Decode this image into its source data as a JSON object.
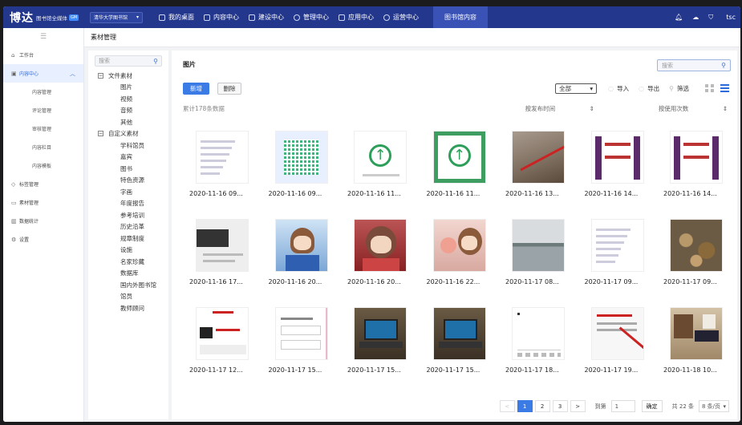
{
  "topbar": {
    "logo": "博达",
    "logo_sub": "图书馆全媒体",
    "logo_badge": "GM",
    "org": "清华大学图书馆",
    "nav": [
      {
        "label": "我的桌面",
        "icon": "desktop-icon"
      },
      {
        "label": "内容中心",
        "icon": "content-icon"
      },
      {
        "label": "建设中心",
        "icon": "build-icon"
      },
      {
        "label": "管理中心",
        "icon": "settings-icon"
      },
      {
        "label": "应用中心",
        "icon": "apps-icon"
      },
      {
        "label": "运营中心",
        "icon": "clock-icon"
      }
    ],
    "active_tab": "图书馆内容",
    "user": "tsc"
  },
  "sidebar": {
    "items": [
      {
        "label": "工作台",
        "icon": "home-icon"
      },
      {
        "label": "内容中心",
        "icon": "content-icon",
        "active": true
      },
      {
        "label": "内容管理"
      },
      {
        "label": "评论管理"
      },
      {
        "label": "审核管理"
      },
      {
        "label": "内容栏目"
      },
      {
        "label": "内容模板"
      },
      {
        "label": "标签管理",
        "icon": "tag-icon"
      },
      {
        "label": "素材管理",
        "icon": "folder-icon"
      },
      {
        "label": "数据统计",
        "icon": "chart-icon"
      },
      {
        "label": "设置",
        "icon": "gear-icon"
      }
    ]
  },
  "breadcrumb": "素材管理",
  "tree": {
    "search_placeholder": "搜索",
    "groups": [
      {
        "label": "文件素材",
        "children": [
          "图片",
          "视频",
          "音频",
          "其他"
        ]
      },
      {
        "label": "自定义素材",
        "children": [
          "学科馆员",
          "嘉宾",
          "图书",
          "特色资源",
          "字画",
          "年度报告",
          "参考培训",
          "历史沿革",
          "规章制度",
          "设施",
          "名家珍藏",
          "数据库",
          "国内外图书馆",
          "馆员",
          "教师顾问"
        ]
      }
    ]
  },
  "main": {
    "title": "图片",
    "search_placeholder": "搜索",
    "new_label": "新增",
    "delete_label": "删除",
    "filter_value": "全部",
    "import_label": "导入",
    "export_label": "导出",
    "screen_label": "筛选",
    "count_text": "累计178条数据",
    "sort_time": "按发布时间",
    "sort_usage": "按使用次数",
    "items": [
      {
        "caption": "2020-11-16 09...",
        "kind": "doc"
      },
      {
        "caption": "2020-11-16 09...",
        "kind": "qr"
      },
      {
        "caption": "2020-11-16 11...",
        "kind": "arrow"
      },
      {
        "caption": "2020-11-16 11...",
        "kind": "arrow-green"
      },
      {
        "caption": "2020-11-16 13...",
        "kind": "photo-brown"
      },
      {
        "caption": "2020-11-16 14...",
        "kind": "purple-ui"
      },
      {
        "caption": "2020-11-16 14...",
        "kind": "purple-ui"
      },
      {
        "caption": "2020-11-16 17...",
        "kind": "web-dark"
      },
      {
        "caption": "2020-11-16 20...",
        "kind": "anime-blue"
      },
      {
        "caption": "2020-11-16 20...",
        "kind": "anime-red"
      },
      {
        "caption": "2020-11-16 22...",
        "kind": "anime-pink"
      },
      {
        "caption": "2020-11-17 08...",
        "kind": "photo-lake"
      },
      {
        "caption": "2020-11-17 09...",
        "kind": "doc"
      },
      {
        "caption": "2020-11-17 09...",
        "kind": "photo-leaves"
      },
      {
        "caption": "2020-11-17 12...",
        "kind": "web-red"
      },
      {
        "caption": "2020-11-17 15...",
        "kind": "doc-pink"
      },
      {
        "caption": "2020-11-17 15...",
        "kind": "photo-laptop"
      },
      {
        "caption": "2020-11-17 15...",
        "kind": "photo-laptop"
      },
      {
        "caption": "2020-11-17 18...",
        "kind": "doc-blank"
      },
      {
        "caption": "2020-11-17 19...",
        "kind": "doc-red"
      },
      {
        "caption": "2020-11-18 10...",
        "kind": "photo-room"
      }
    ]
  },
  "pager": {
    "prev": "<",
    "pages": [
      "1",
      "2",
      "3"
    ],
    "current": "1",
    "next": ">",
    "goto_label": "到第",
    "goto_value": "1",
    "goto_button": "确定",
    "total": "共 22 条",
    "page_size": "8 条/页"
  },
  "colors": {
    "brand": "#23378d",
    "accent": "#3a7be6"
  }
}
